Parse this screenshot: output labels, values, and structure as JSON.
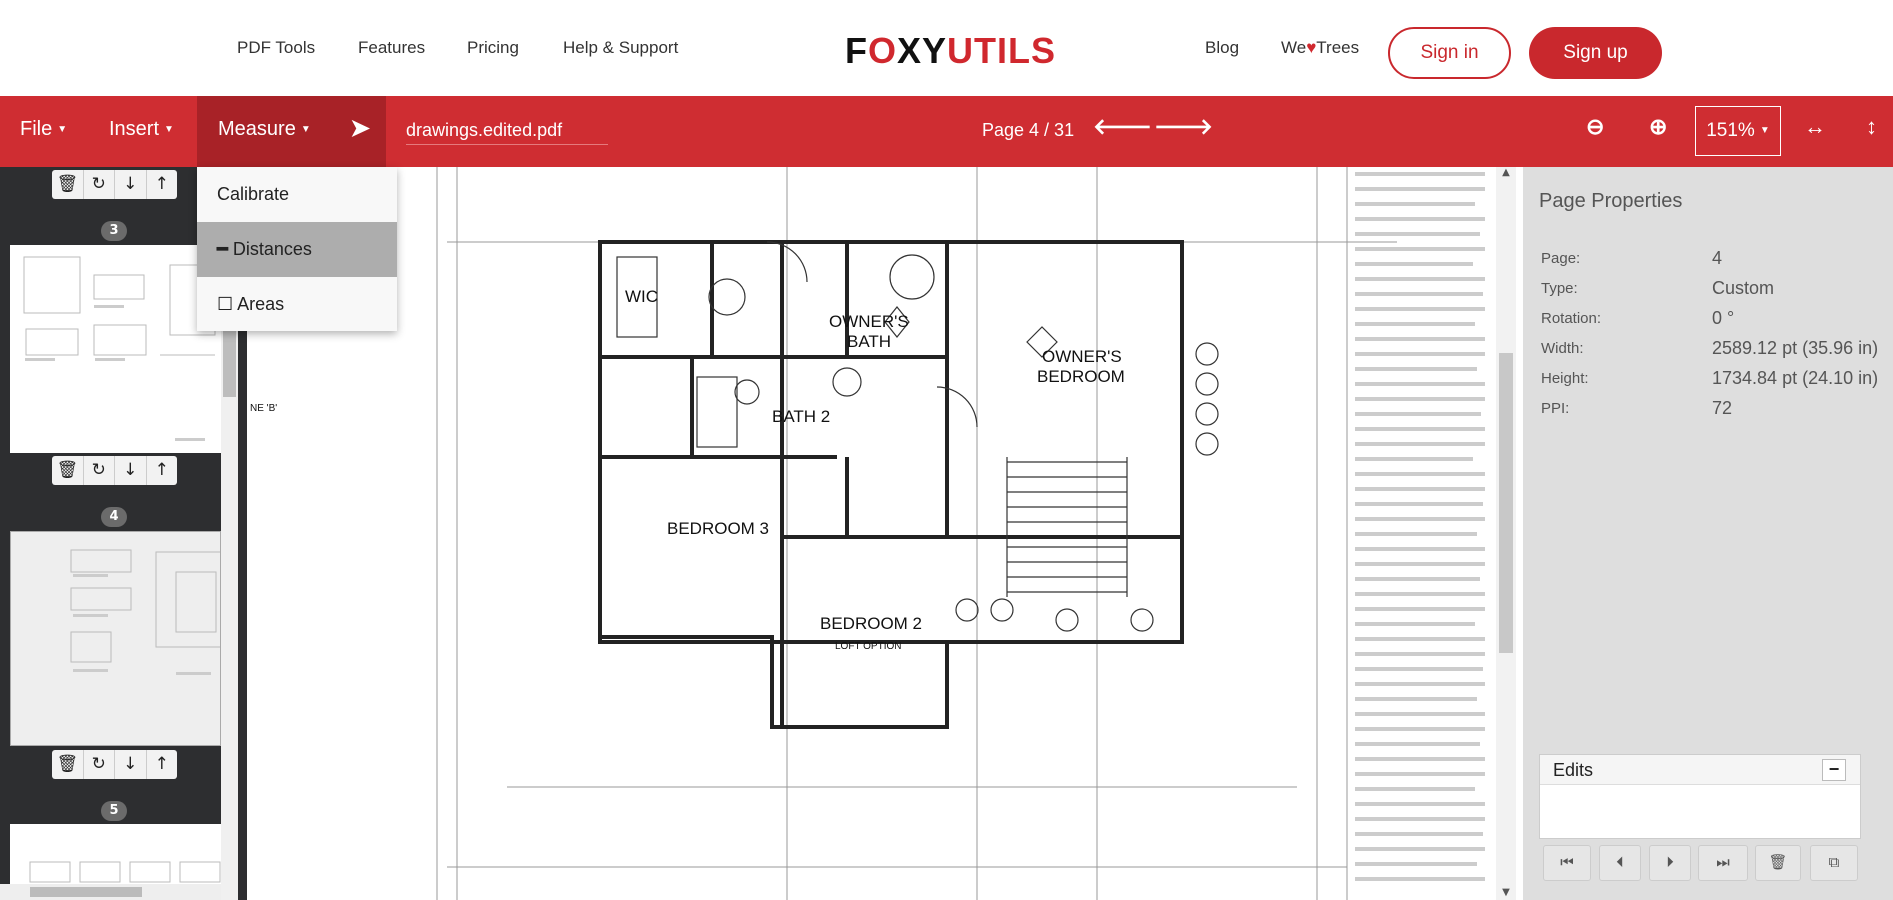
{
  "header": {
    "nav": [
      "PDF Tools",
      "Features",
      "Pricing",
      "Help & Support"
    ],
    "logo": {
      "left": "F",
      "o": "O",
      "right": "XY",
      "utils": "UTILS"
    },
    "blog": "Blog",
    "we_trees": {
      "we": "We",
      "heart": "♥",
      "trees": "Trees"
    },
    "sign_in": "Sign in",
    "sign_up": "Sign up",
    "brand_color": "#cf2d32"
  },
  "toolbar": {
    "file": "File",
    "insert": "Insert",
    "measure": "Measure",
    "filename": "drawings.edited.pdf",
    "page_indicator": "Page 4 / 31",
    "zoom": "151%"
  },
  "measure_menu": {
    "items": [
      {
        "label": "Calibrate",
        "icon": ""
      },
      {
        "label": "Distances",
        "icon": "line-icon"
      },
      {
        "label": "Areas",
        "icon": "square-icon"
      }
    ],
    "active": "Distances"
  },
  "thumbnails": {
    "pages": [
      "3",
      "4",
      "5"
    ],
    "selected": "4"
  },
  "drawing": {
    "rooms": [
      "WIC",
      "OWNER'S",
      "BATH",
      "OWNER'S",
      "BEDROOM",
      "BATH 2",
      "BEDROOM 3",
      "BEDROOM 2",
      "LOFT OPTION"
    ],
    "marker": "NE 'B'"
  },
  "page_properties": {
    "title": "Page Properties",
    "rows": [
      {
        "label": "Page:",
        "value": "4"
      },
      {
        "label": "Type:",
        "value": "Custom"
      },
      {
        "label": "Rotation:",
        "value": "0 °"
      },
      {
        "label": "Width:",
        "value": "2589.12 pt (35.96 in)"
      },
      {
        "label": "Height:",
        "value": "1734.84 pt (24.10 in)"
      },
      {
        "label": "PPI:",
        "value": "72"
      }
    ]
  },
  "edits": {
    "title": "Edits"
  }
}
